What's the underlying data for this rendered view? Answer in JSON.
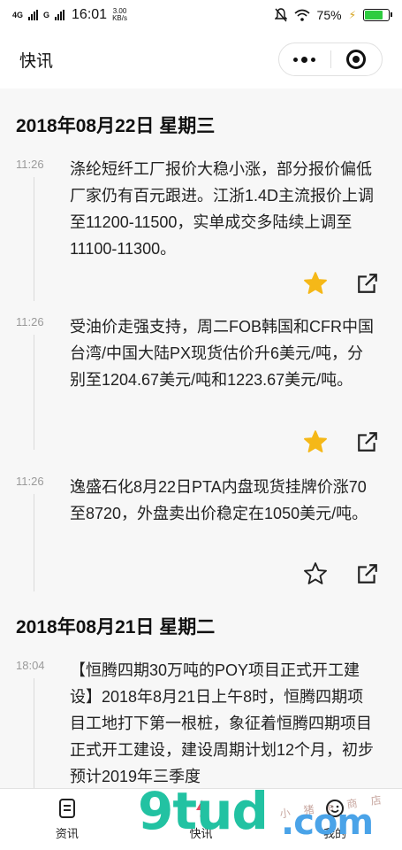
{
  "status_bar": {
    "network": "4G",
    "network2": "G",
    "time": "16:01",
    "speed_value": "3.00",
    "speed_unit": "KB/s",
    "battery": "75%",
    "battery_level": 0.75
  },
  "app_bar": {
    "title": "快讯",
    "more_icon": "more-dots-icon",
    "close_icon": "target-circle-icon"
  },
  "feed": {
    "sections": [
      {
        "date": "2018年08月22日 星期三",
        "entries": [
          {
            "time": "11:26",
            "text": "涤纶短纤工厂报价大稳小涨，部分报价偏低厂家仍有百元跟进。江浙1.4D主流报价上调至11200-11500，实单成交多陆续上调至11100-11300。",
            "starred": true
          },
          {
            "time": "11:26",
            "text": "受油价走强支持，周二FOB韩国和CFR中国台湾/中国大陆PX现货估价升6美元/吨，分别至1204.67美元/吨和1223.67美元/吨。",
            "starred": true
          },
          {
            "time": "11:26",
            "text": "逸盛石化8月22日PTA内盘现货挂牌价涨70至8720，外盘卖出价稳定在1050美元/吨。",
            "starred": false
          }
        ]
      },
      {
        "date": "2018年08月21日 星期二",
        "entries": [
          {
            "time": "18:04",
            "text": "【恒腾四期30万吨的POY项目正式开工建设】2018年8月21日上午8时，恒腾四期项目工地打下第一根桩，象征着恒腾四期项目正式开工建设，建设周期计划12个月，初步预计2019年三季度",
            "starred": false
          }
        ]
      }
    ]
  },
  "tab_bar": {
    "tabs": [
      {
        "label": "资讯",
        "icon": "document-icon"
      },
      {
        "label": "快讯",
        "icon": "flash-icon"
      },
      {
        "label": "我的",
        "icon": "smile-icon"
      }
    ]
  },
  "watermark": {
    "big": "9tud",
    "dot_com": ".com",
    "small": "小 猪 e 商 店"
  },
  "colors": {
    "star_filled": "#f5b818",
    "accent_green": "#22c2a2",
    "accent_pink": "#f07ab0",
    "accent_blue": "#4aa3e8"
  }
}
